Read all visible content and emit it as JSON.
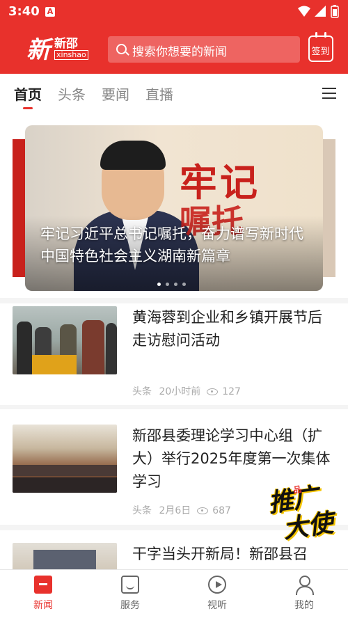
{
  "status_bar": {
    "time": "3:40",
    "app_badge": "A"
  },
  "header": {
    "logo_big": "新",
    "logo_small": "新邵",
    "logo_sub": "xinshao",
    "search_placeholder": "搜索你想要的新闻",
    "checkin_label": "签到"
  },
  "tabs": [
    {
      "label": "首页",
      "active": true
    },
    {
      "label": "头条",
      "active": false
    },
    {
      "label": "要闻",
      "active": false
    },
    {
      "label": "直播",
      "active": false
    }
  ],
  "banner": {
    "headline_line1": "牢记",
    "headline_line2": "嘱托",
    "caption": "牢记习近平总书记嘱托，奋力谱写新时代中国特色社会主义湖南新篇章",
    "dot_count": 4,
    "active_dot": 1
  },
  "news": [
    {
      "title": "黄海蓉到企业和乡镇开展节后走访慰问活动",
      "source": "头条",
      "time": "20小时前",
      "views": "127"
    },
    {
      "title": "新邵县委理论学习中心组（扩大）举行2025年度第一次集体学习",
      "source": "头条",
      "time": "2月6日",
      "views": "687"
    },
    {
      "title": "干字当头开新局！新邵县召",
      "source": "",
      "time": "",
      "views": ""
    }
  ],
  "floating_badge": {
    "line1": "推广",
    "line2": "大使",
    "small": "品"
  },
  "bottom_nav": [
    {
      "label": "新闻",
      "icon": "news-icon",
      "active": true
    },
    {
      "label": "服务",
      "icon": "service-icon",
      "active": false
    },
    {
      "label": "视听",
      "icon": "video-play-icon",
      "active": false
    },
    {
      "label": "我的",
      "icon": "profile-icon",
      "active": false
    }
  ],
  "colors": {
    "brand_red": "#e8312c",
    "text_dark": "#222222",
    "text_muted": "#aaaaaa"
  }
}
